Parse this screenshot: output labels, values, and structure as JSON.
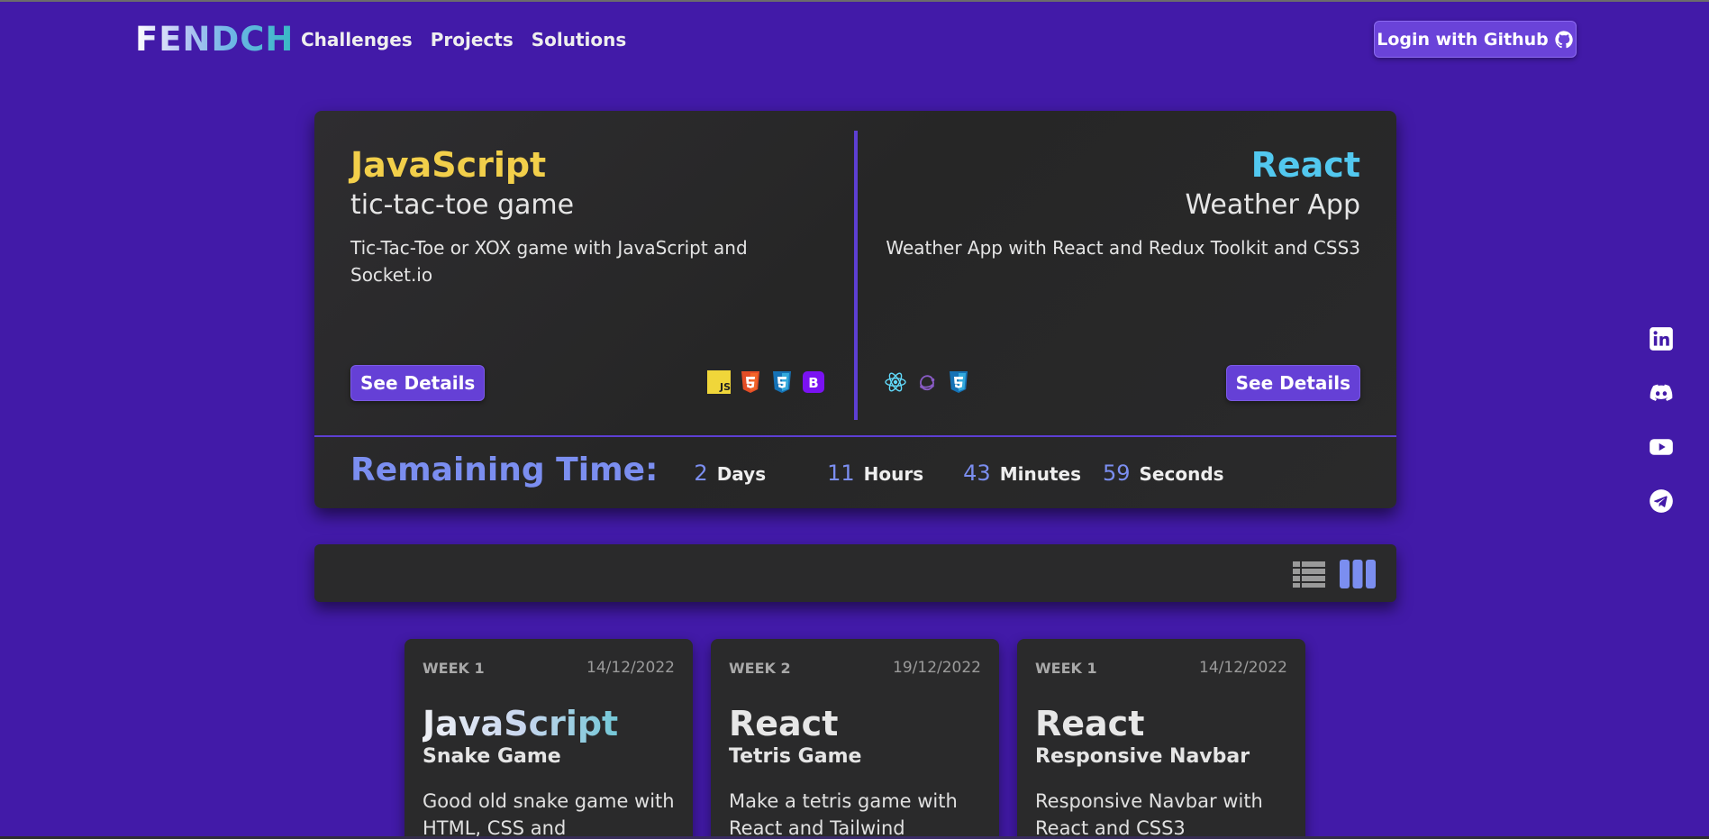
{
  "header": {
    "logo": "FENDCH",
    "nav": [
      "Challenges",
      "Projects",
      "Solutions"
    ],
    "login_label": "Login with Github",
    "login_icon": "github-icon"
  },
  "hero": {
    "left": {
      "tech": "JavaScript",
      "title": "tic-tac-toe game",
      "description": "Tic-Tac-Toe or XOX game with JavaScript and Socket.io",
      "button": "See Details",
      "icons": [
        "javascript-icon",
        "html5-icon",
        "css3-icon",
        "bootstrap-icon"
      ]
    },
    "right": {
      "tech": "React",
      "title": "Weather App",
      "description": "Weather App with React and Redux Toolkit and CSS3",
      "button": "See Details",
      "icons": [
        "react-icon",
        "redux-icon",
        "css3-icon"
      ]
    },
    "remaining": {
      "label": "Remaining Time:",
      "days": "2",
      "days_label": "Days",
      "hours": "11",
      "hours_label": "Hours",
      "minutes": "43",
      "minutes_label": "Minutes",
      "seconds": "59",
      "seconds_label": "Seconds"
    }
  },
  "toolbar": {
    "views": [
      "list-view-icon",
      "grid-view-icon"
    ],
    "active_view": "grid"
  },
  "cards": [
    {
      "week": "WEEK 1",
      "date": "14/12/2022",
      "tech": "JavaScript",
      "title": "Snake Game",
      "description": "Good old snake game with HTML, CSS and"
    },
    {
      "week": "WEEK 2",
      "date": "19/12/2022",
      "tech": "React",
      "title": "Tetris Game",
      "description": "Make a tetris game with React and Tailwind"
    },
    {
      "week": "WEEK 1",
      "date": "14/12/2022",
      "tech": "React",
      "title": "Responsive Navbar",
      "description": "Responsive Navbar with React and CSS3"
    }
  ],
  "social": [
    "linkedin-icon",
    "discord-icon",
    "youtube-icon",
    "telegram-icon"
  ],
  "colors": {
    "background": "#421aa8",
    "card": "#2a2a2b",
    "accent": "#6540d6",
    "javascript": "#f2cf4a",
    "react": "#52c8ef",
    "timer": "#7b8ef0"
  }
}
